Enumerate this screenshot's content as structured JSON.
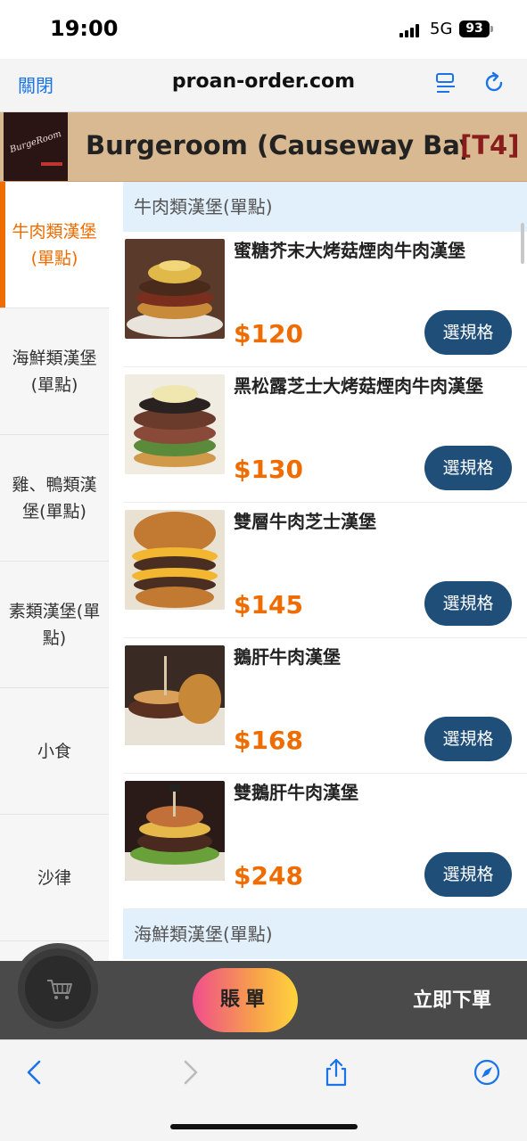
{
  "status_bar": {
    "time": "19:00",
    "network": "5G",
    "battery": "93"
  },
  "browser": {
    "close_label": "關閉",
    "url": "proan-order.com"
  },
  "shop": {
    "name": "Burgeroom (Causeway Bay)",
    "table": "[T4]"
  },
  "categories": [
    {
      "label": "牛肉類漢堡(單點)",
      "active": true
    },
    {
      "label": "海鮮類漢堡(單點)",
      "active": false
    },
    {
      "label": "雞、鴨類漢堡(單點)",
      "active": false
    },
    {
      "label": "素類漢堡(單點)",
      "active": false
    },
    {
      "label": "小食",
      "active": false
    },
    {
      "label": "沙律",
      "active": false
    }
  ],
  "section": {
    "title": "牛肉類漢堡(單點)"
  },
  "products": [
    {
      "name": "蜜糖芥末大烤菇煙肉牛肉漢堡",
      "price": "$120",
      "button": "選規格"
    },
    {
      "name": "黑松露芝士大烤菇煙肉牛肉漢堡",
      "price": "$130",
      "button": "選規格"
    },
    {
      "name": "雙層牛肉芝士漢堡",
      "price": "$145",
      "button": "選規格"
    },
    {
      "name": "鵝肝牛肉漢堡",
      "price": "$168",
      "button": "選規格"
    },
    {
      "name": "雙鵝肝牛肉漢堡",
      "price": "$248",
      "button": "選規格"
    }
  ],
  "next_section": {
    "title": "海鮮類漢堡(單點)"
  },
  "action_bar": {
    "cart_icon": "shopping-cart-icon",
    "bill_label": "賬單",
    "order_label": "立即下單"
  },
  "colors": {
    "accent": "#ef6c00",
    "button": "#1f4e79",
    "header_bg": "#d9b991",
    "section_bg": "#e2f0fb"
  }
}
